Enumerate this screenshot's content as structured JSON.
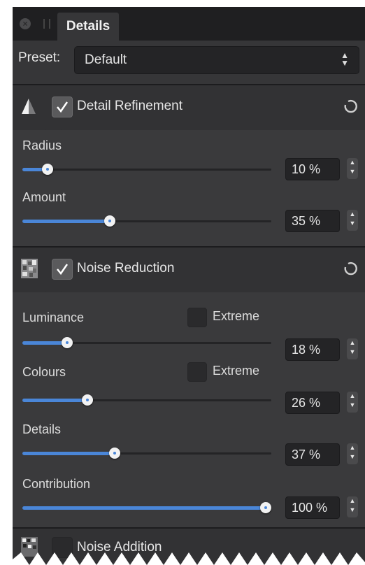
{
  "tabs": [
    {
      "label": "Details",
      "active": true
    }
  ],
  "preset": {
    "label": "Preset:",
    "value": "Default"
  },
  "sections": {
    "detail_refinement": {
      "title": "Detail Refinement",
      "checked": true,
      "radius": {
        "label": "Radius",
        "value_text": "10 %",
        "value": 10
      },
      "amount": {
        "label": "Amount",
        "value_text": "35 %",
        "value": 35
      }
    },
    "noise_reduction": {
      "title": "Noise Reduction",
      "checked": true,
      "luminance": {
        "label": "Luminance",
        "extreme_label": "Extreme",
        "extreme_checked": false,
        "value_text": "18 %",
        "value": 18
      },
      "colours": {
        "label": "Colours",
        "extreme_label": "Extreme",
        "extreme_checked": false,
        "value_text": "26 %",
        "value": 26
      },
      "details": {
        "label": "Details",
        "value_text": "37 %",
        "value": 37
      },
      "contribution": {
        "label": "Contribution",
        "value_text": "100 %",
        "value": 100
      }
    },
    "noise_addition": {
      "title": "Noise Addition",
      "checked": false
    }
  },
  "colors": {
    "accent": "#4a86d8",
    "panel_bg": "#2e2e30",
    "body_bg": "#3a3a3c"
  }
}
